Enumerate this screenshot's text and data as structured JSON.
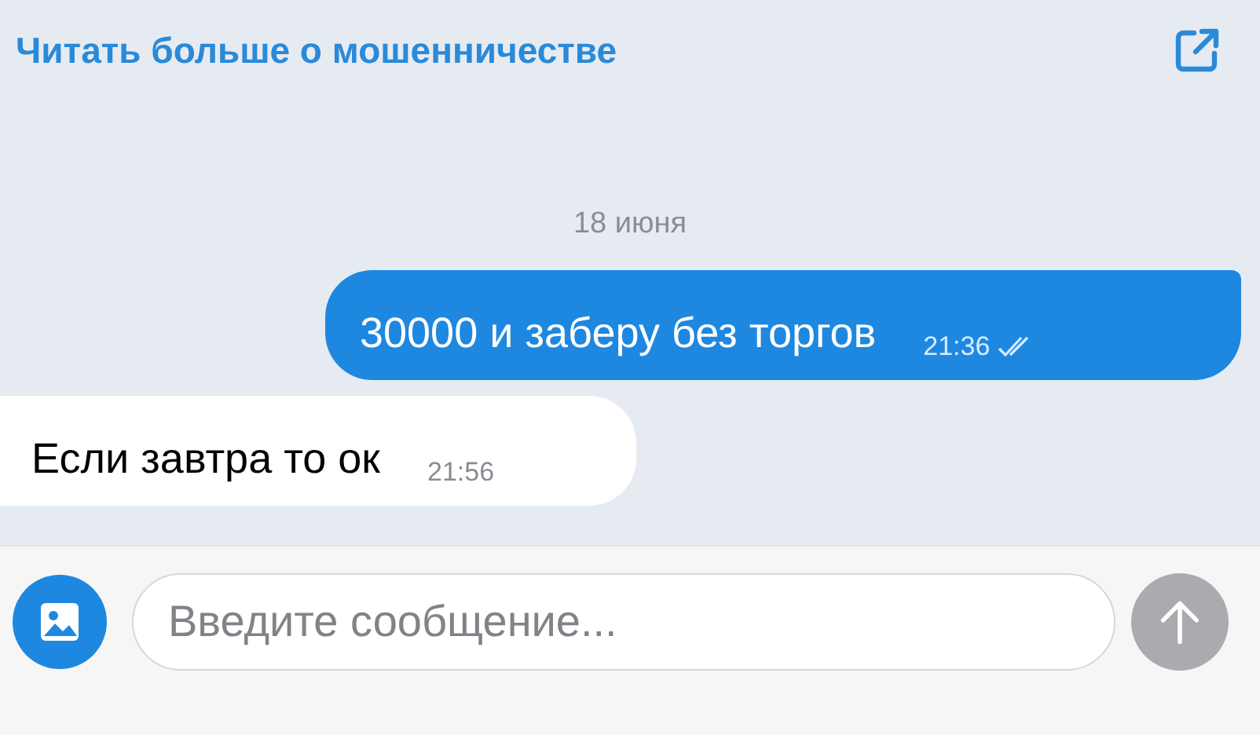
{
  "header": {
    "link": "Читать больше о мошенничестве"
  },
  "date": "18 июня",
  "messages": [
    {
      "kind": "outgoing",
      "text": "30000 и заберу без торгов",
      "time": "21:36",
      "read": true
    },
    {
      "kind": "incoming",
      "text": "Если завтра то ок",
      "time": "21:56"
    }
  ],
  "composer": {
    "placeholder": "Введите сообщение...",
    "send_disabled": true
  }
}
